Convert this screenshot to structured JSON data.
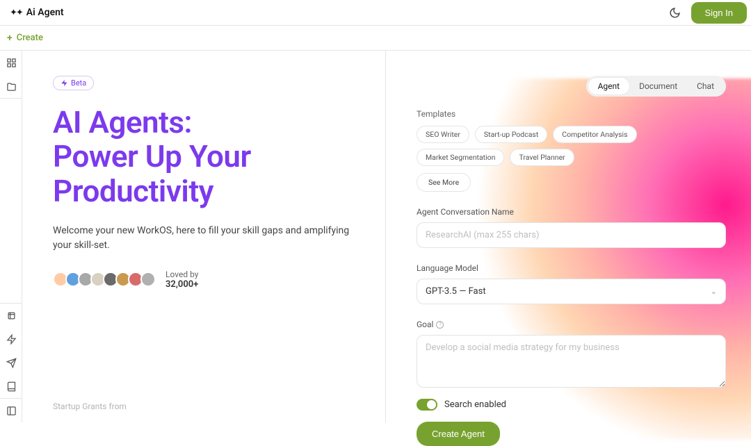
{
  "header": {
    "logo_text": "Ai Agent",
    "signin_label": "Sign In"
  },
  "create_bar": {
    "create_label": "Create"
  },
  "left": {
    "beta_label": "Beta",
    "hero_line1": "AI Agents:",
    "hero_line2": "Power Up Your",
    "hero_line3": "Productivity",
    "subtitle": "Welcome your new WorkOS, here to fill your skill gaps and amplifying your skill-set.",
    "loved_by_label": "Loved by",
    "loved_by_count": "32,000+",
    "grants_from": "Startup Grants from",
    "avatar_colors": [
      "#ffcba4",
      "#5fa0e0",
      "#a8a8a8",
      "#d8d0c0",
      "#6a6a6a",
      "#c89a50",
      "#d96a6a",
      "#b0b0b0"
    ]
  },
  "right": {
    "tabs": [
      "Agent",
      "Document",
      "Chat"
    ],
    "active_tab_index": 0,
    "templates_label": "Templates",
    "templates": [
      "SEO Writer",
      "Start-up Podcast",
      "Competitor Analysis",
      "Market Segmentation",
      "Travel Planner"
    ],
    "see_more_label": "See More",
    "name_label": "Agent Conversation Name",
    "name_placeholder": "ResearchAI (max 255 chars)",
    "name_value": "",
    "model_label": "Language Model",
    "model_value": "GPT-3.5 — Fast",
    "goal_label": "Goal",
    "goal_placeholder": "Develop a social media strategy for my business",
    "goal_value": "",
    "search_toggle_label": "Search enabled",
    "search_enabled": true,
    "create_agent_label": "Create Agent"
  }
}
